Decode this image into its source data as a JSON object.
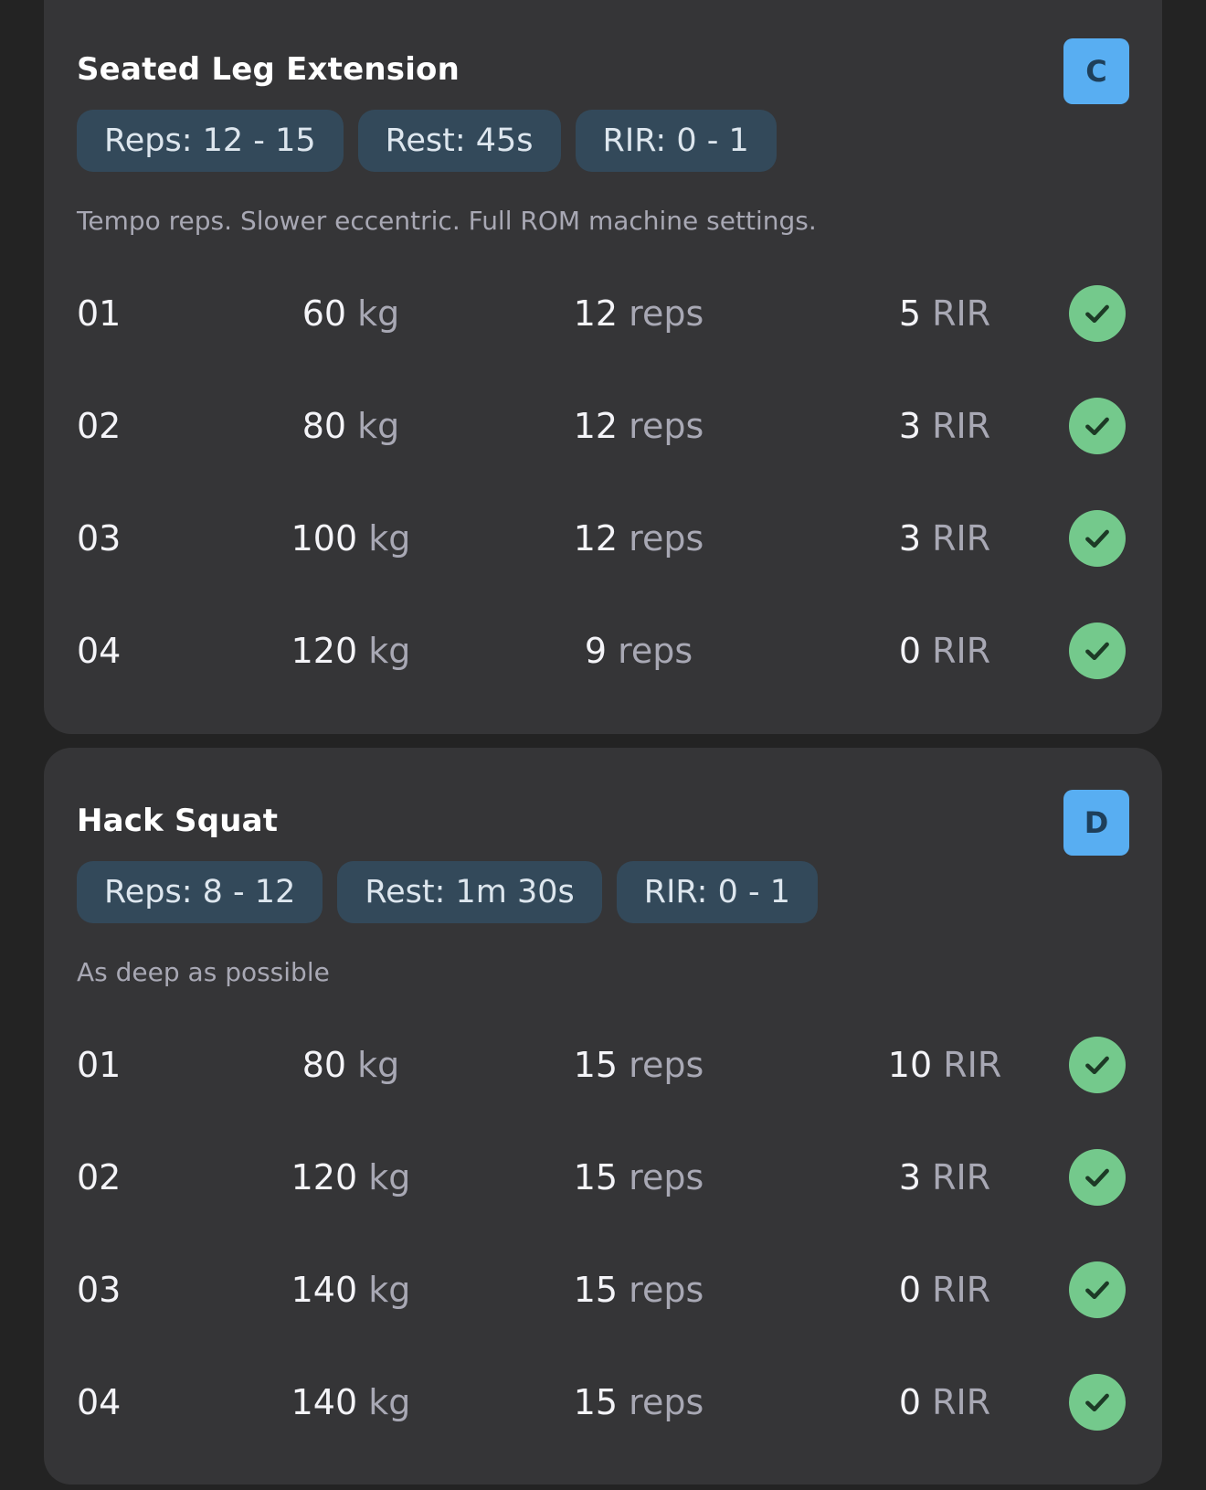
{
  "exercises": [
    {
      "name": "Seated Leg Extension",
      "badge": "C",
      "chips": [
        "Reps: 12 - 15",
        "Rest: 45s",
        "RIR: 0 - 1"
      ],
      "note": "Tempo reps. Slower eccentric. Full ROM machine settings.",
      "sets": [
        {
          "num": "01",
          "weight": "60",
          "weight_unit": "kg",
          "reps": "12",
          "reps_unit": "reps",
          "rir": "5",
          "rir_unit": "RIR",
          "done": true
        },
        {
          "num": "02",
          "weight": "80",
          "weight_unit": "kg",
          "reps": "12",
          "reps_unit": "reps",
          "rir": "3",
          "rir_unit": "RIR",
          "done": true
        },
        {
          "num": "03",
          "weight": "100",
          "weight_unit": "kg",
          "reps": "12",
          "reps_unit": "reps",
          "rir": "3",
          "rir_unit": "RIR",
          "done": true
        },
        {
          "num": "04",
          "weight": "120",
          "weight_unit": "kg",
          "reps": "9",
          "reps_unit": "reps",
          "rir": "0",
          "rir_unit": "RIR",
          "done": true
        }
      ]
    },
    {
      "name": "Hack Squat",
      "badge": "D",
      "chips": [
        "Reps: 8 - 12",
        "Rest: 1m 30s",
        "RIR: 0 - 1"
      ],
      "note": "As deep as possible",
      "sets": [
        {
          "num": "01",
          "weight": "80",
          "weight_unit": "kg",
          "reps": "15",
          "reps_unit": "reps",
          "rir": "10",
          "rir_unit": "RIR",
          "done": true
        },
        {
          "num": "02",
          "weight": "120",
          "weight_unit": "kg",
          "reps": "15",
          "reps_unit": "reps",
          "rir": "3",
          "rir_unit": "RIR",
          "done": true
        },
        {
          "num": "03",
          "weight": "140",
          "weight_unit": "kg",
          "reps": "15",
          "reps_unit": "reps",
          "rir": "0",
          "rir_unit": "RIR",
          "done": true
        },
        {
          "num": "04",
          "weight": "140",
          "weight_unit": "kg",
          "reps": "15",
          "reps_unit": "reps",
          "rir": "0",
          "rir_unit": "RIR",
          "done": true
        }
      ]
    }
  ],
  "colors": {
    "background": "#232323",
    "card": "#353537",
    "chip": "#33495a",
    "letter_badge": "#58aef2",
    "check": "#74c98c"
  },
  "icons": {
    "set_complete": "check-icon"
  }
}
